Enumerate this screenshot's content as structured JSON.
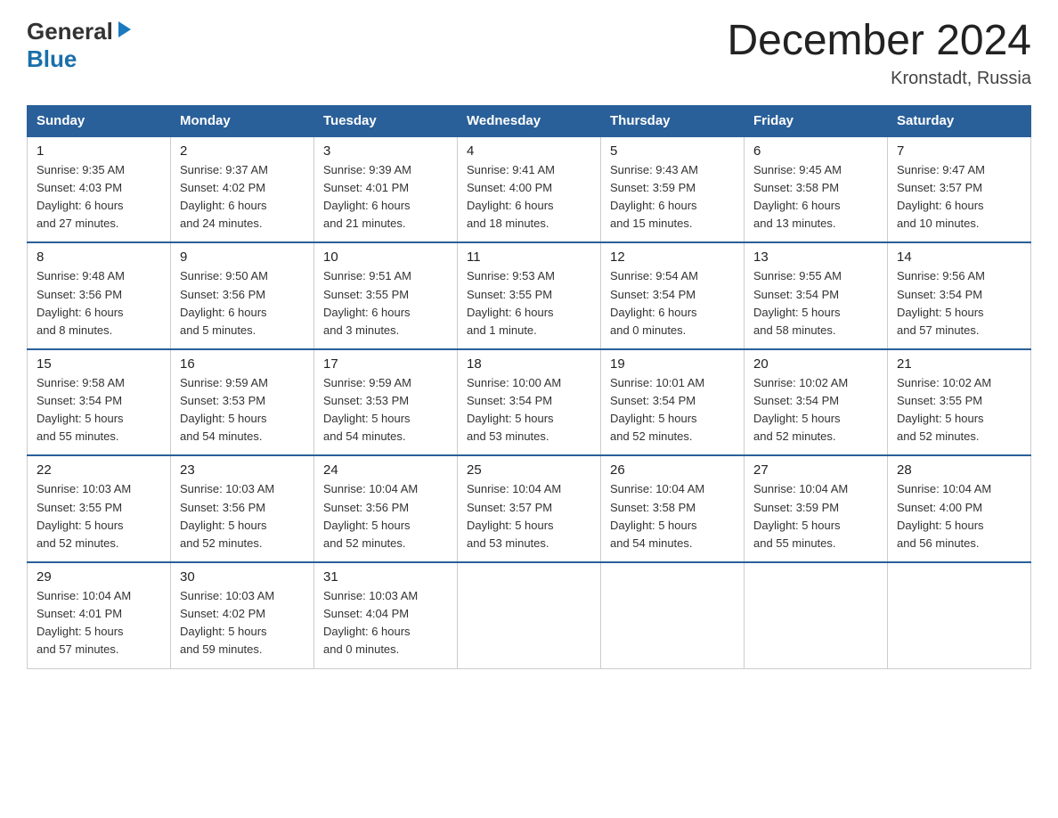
{
  "header": {
    "logo_general": "General",
    "logo_blue": "Blue",
    "title": "December 2024",
    "location": "Kronstadt, Russia"
  },
  "columns": [
    "Sunday",
    "Monday",
    "Tuesday",
    "Wednesday",
    "Thursday",
    "Friday",
    "Saturday"
  ],
  "weeks": [
    [
      {
        "day": "1",
        "info": "Sunrise: 9:35 AM\nSunset: 4:03 PM\nDaylight: 6 hours\nand 27 minutes."
      },
      {
        "day": "2",
        "info": "Sunrise: 9:37 AM\nSunset: 4:02 PM\nDaylight: 6 hours\nand 24 minutes."
      },
      {
        "day": "3",
        "info": "Sunrise: 9:39 AM\nSunset: 4:01 PM\nDaylight: 6 hours\nand 21 minutes."
      },
      {
        "day": "4",
        "info": "Sunrise: 9:41 AM\nSunset: 4:00 PM\nDaylight: 6 hours\nand 18 minutes."
      },
      {
        "day": "5",
        "info": "Sunrise: 9:43 AM\nSunset: 3:59 PM\nDaylight: 6 hours\nand 15 minutes."
      },
      {
        "day": "6",
        "info": "Sunrise: 9:45 AM\nSunset: 3:58 PM\nDaylight: 6 hours\nand 13 minutes."
      },
      {
        "day": "7",
        "info": "Sunrise: 9:47 AM\nSunset: 3:57 PM\nDaylight: 6 hours\nand 10 minutes."
      }
    ],
    [
      {
        "day": "8",
        "info": "Sunrise: 9:48 AM\nSunset: 3:56 PM\nDaylight: 6 hours\nand 8 minutes."
      },
      {
        "day": "9",
        "info": "Sunrise: 9:50 AM\nSunset: 3:56 PM\nDaylight: 6 hours\nand 5 minutes."
      },
      {
        "day": "10",
        "info": "Sunrise: 9:51 AM\nSunset: 3:55 PM\nDaylight: 6 hours\nand 3 minutes."
      },
      {
        "day": "11",
        "info": "Sunrise: 9:53 AM\nSunset: 3:55 PM\nDaylight: 6 hours\nand 1 minute."
      },
      {
        "day": "12",
        "info": "Sunrise: 9:54 AM\nSunset: 3:54 PM\nDaylight: 6 hours\nand 0 minutes."
      },
      {
        "day": "13",
        "info": "Sunrise: 9:55 AM\nSunset: 3:54 PM\nDaylight: 5 hours\nand 58 minutes."
      },
      {
        "day": "14",
        "info": "Sunrise: 9:56 AM\nSunset: 3:54 PM\nDaylight: 5 hours\nand 57 minutes."
      }
    ],
    [
      {
        "day": "15",
        "info": "Sunrise: 9:58 AM\nSunset: 3:54 PM\nDaylight: 5 hours\nand 55 minutes."
      },
      {
        "day": "16",
        "info": "Sunrise: 9:59 AM\nSunset: 3:53 PM\nDaylight: 5 hours\nand 54 minutes."
      },
      {
        "day": "17",
        "info": "Sunrise: 9:59 AM\nSunset: 3:53 PM\nDaylight: 5 hours\nand 54 minutes."
      },
      {
        "day": "18",
        "info": "Sunrise: 10:00 AM\nSunset: 3:54 PM\nDaylight: 5 hours\nand 53 minutes."
      },
      {
        "day": "19",
        "info": "Sunrise: 10:01 AM\nSunset: 3:54 PM\nDaylight: 5 hours\nand 52 minutes."
      },
      {
        "day": "20",
        "info": "Sunrise: 10:02 AM\nSunset: 3:54 PM\nDaylight: 5 hours\nand 52 minutes."
      },
      {
        "day": "21",
        "info": "Sunrise: 10:02 AM\nSunset: 3:55 PM\nDaylight: 5 hours\nand 52 minutes."
      }
    ],
    [
      {
        "day": "22",
        "info": "Sunrise: 10:03 AM\nSunset: 3:55 PM\nDaylight: 5 hours\nand 52 minutes."
      },
      {
        "day": "23",
        "info": "Sunrise: 10:03 AM\nSunset: 3:56 PM\nDaylight: 5 hours\nand 52 minutes."
      },
      {
        "day": "24",
        "info": "Sunrise: 10:04 AM\nSunset: 3:56 PM\nDaylight: 5 hours\nand 52 minutes."
      },
      {
        "day": "25",
        "info": "Sunrise: 10:04 AM\nSunset: 3:57 PM\nDaylight: 5 hours\nand 53 minutes."
      },
      {
        "day": "26",
        "info": "Sunrise: 10:04 AM\nSunset: 3:58 PM\nDaylight: 5 hours\nand 54 minutes."
      },
      {
        "day": "27",
        "info": "Sunrise: 10:04 AM\nSunset: 3:59 PM\nDaylight: 5 hours\nand 55 minutes."
      },
      {
        "day": "28",
        "info": "Sunrise: 10:04 AM\nSunset: 4:00 PM\nDaylight: 5 hours\nand 56 minutes."
      }
    ],
    [
      {
        "day": "29",
        "info": "Sunrise: 10:04 AM\nSunset: 4:01 PM\nDaylight: 5 hours\nand 57 minutes."
      },
      {
        "day": "30",
        "info": "Sunrise: 10:03 AM\nSunset: 4:02 PM\nDaylight: 5 hours\nand 59 minutes."
      },
      {
        "day": "31",
        "info": "Sunrise: 10:03 AM\nSunset: 4:04 PM\nDaylight: 6 hours\nand 0 minutes."
      },
      {
        "day": "",
        "info": ""
      },
      {
        "day": "",
        "info": ""
      },
      {
        "day": "",
        "info": ""
      },
      {
        "day": "",
        "info": ""
      }
    ]
  ]
}
